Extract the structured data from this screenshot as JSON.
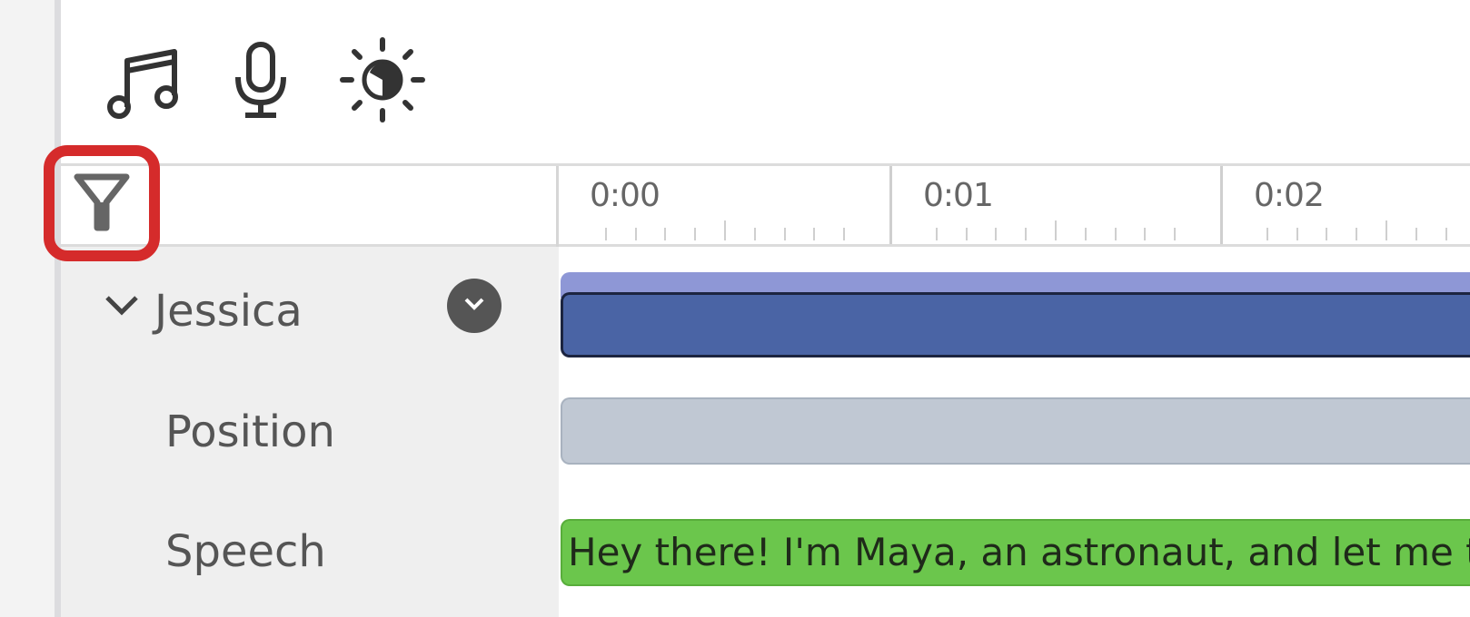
{
  "toolbar": {
    "icons": [
      "music-note-icon",
      "microphone-icon",
      "brightness-icon"
    ]
  },
  "filter": {
    "icon": "filter-icon",
    "highlight_color": "#d52b2b"
  },
  "ruler": {
    "labels": [
      "0:00",
      "0:01",
      "0:02"
    ]
  },
  "tracks": {
    "group_label": "Jessica",
    "position_label": "Position",
    "speech_label": "Speech",
    "speech_clip_text": "Hey there! I'm Maya, an astronaut, and let me te"
  },
  "colors": {
    "main_clip": "#4a64a5",
    "main_clip_top": "#8e97d6",
    "position_clip": "#c0c8d3",
    "speech_clip": "#6bc64c"
  }
}
